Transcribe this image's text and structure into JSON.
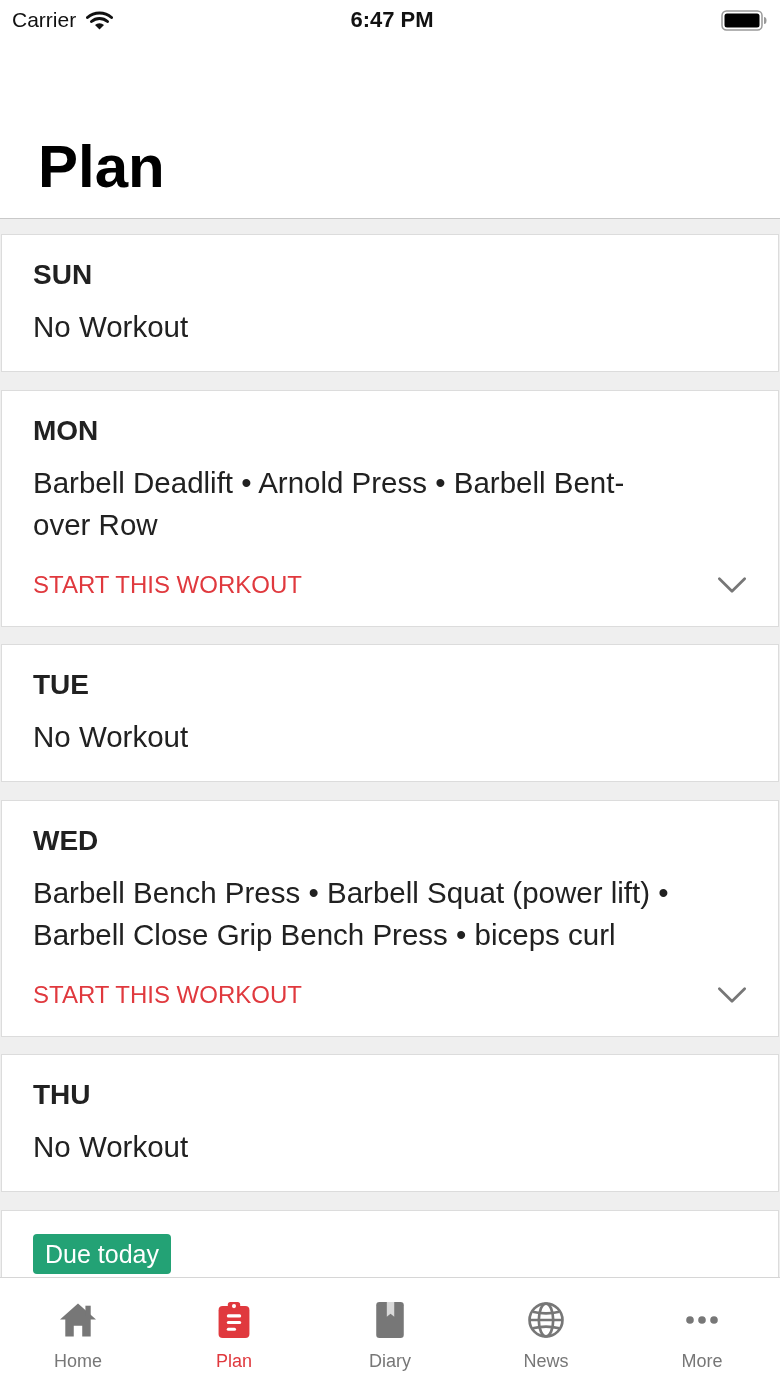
{
  "status_bar": {
    "carrier": "Carrier",
    "time": "6:47 PM"
  },
  "header": {
    "title": "Plan"
  },
  "days": [
    {
      "kind": "rest",
      "day": "SUN",
      "summary": "No Workout"
    },
    {
      "kind": "workout",
      "day": "MON",
      "summary": "Barbell Deadlift • Arnold Press • Barbell Bent-over Row",
      "action": "START THIS WORKOUT",
      "expanded": false
    },
    {
      "kind": "rest",
      "day": "TUE",
      "summary": "No Workout"
    },
    {
      "kind": "workout",
      "day": "WED",
      "summary": "Barbell Bench Press • Barbell Squat (power lift) • Barbell Close Grip Bench Press • biceps curl",
      "action": "START THIS WORKOUT",
      "expanded": false
    },
    {
      "kind": "rest",
      "day": "THU",
      "summary": "No Workout"
    },
    {
      "kind": "due",
      "badge": "Due today"
    }
  ],
  "tab_bar": {
    "items": [
      {
        "label": "Home",
        "selected": false
      },
      {
        "label": "Plan",
        "selected": true
      },
      {
        "label": "Diary",
        "selected": false
      },
      {
        "label": "News",
        "selected": false
      },
      {
        "label": "More",
        "selected": false
      }
    ]
  }
}
